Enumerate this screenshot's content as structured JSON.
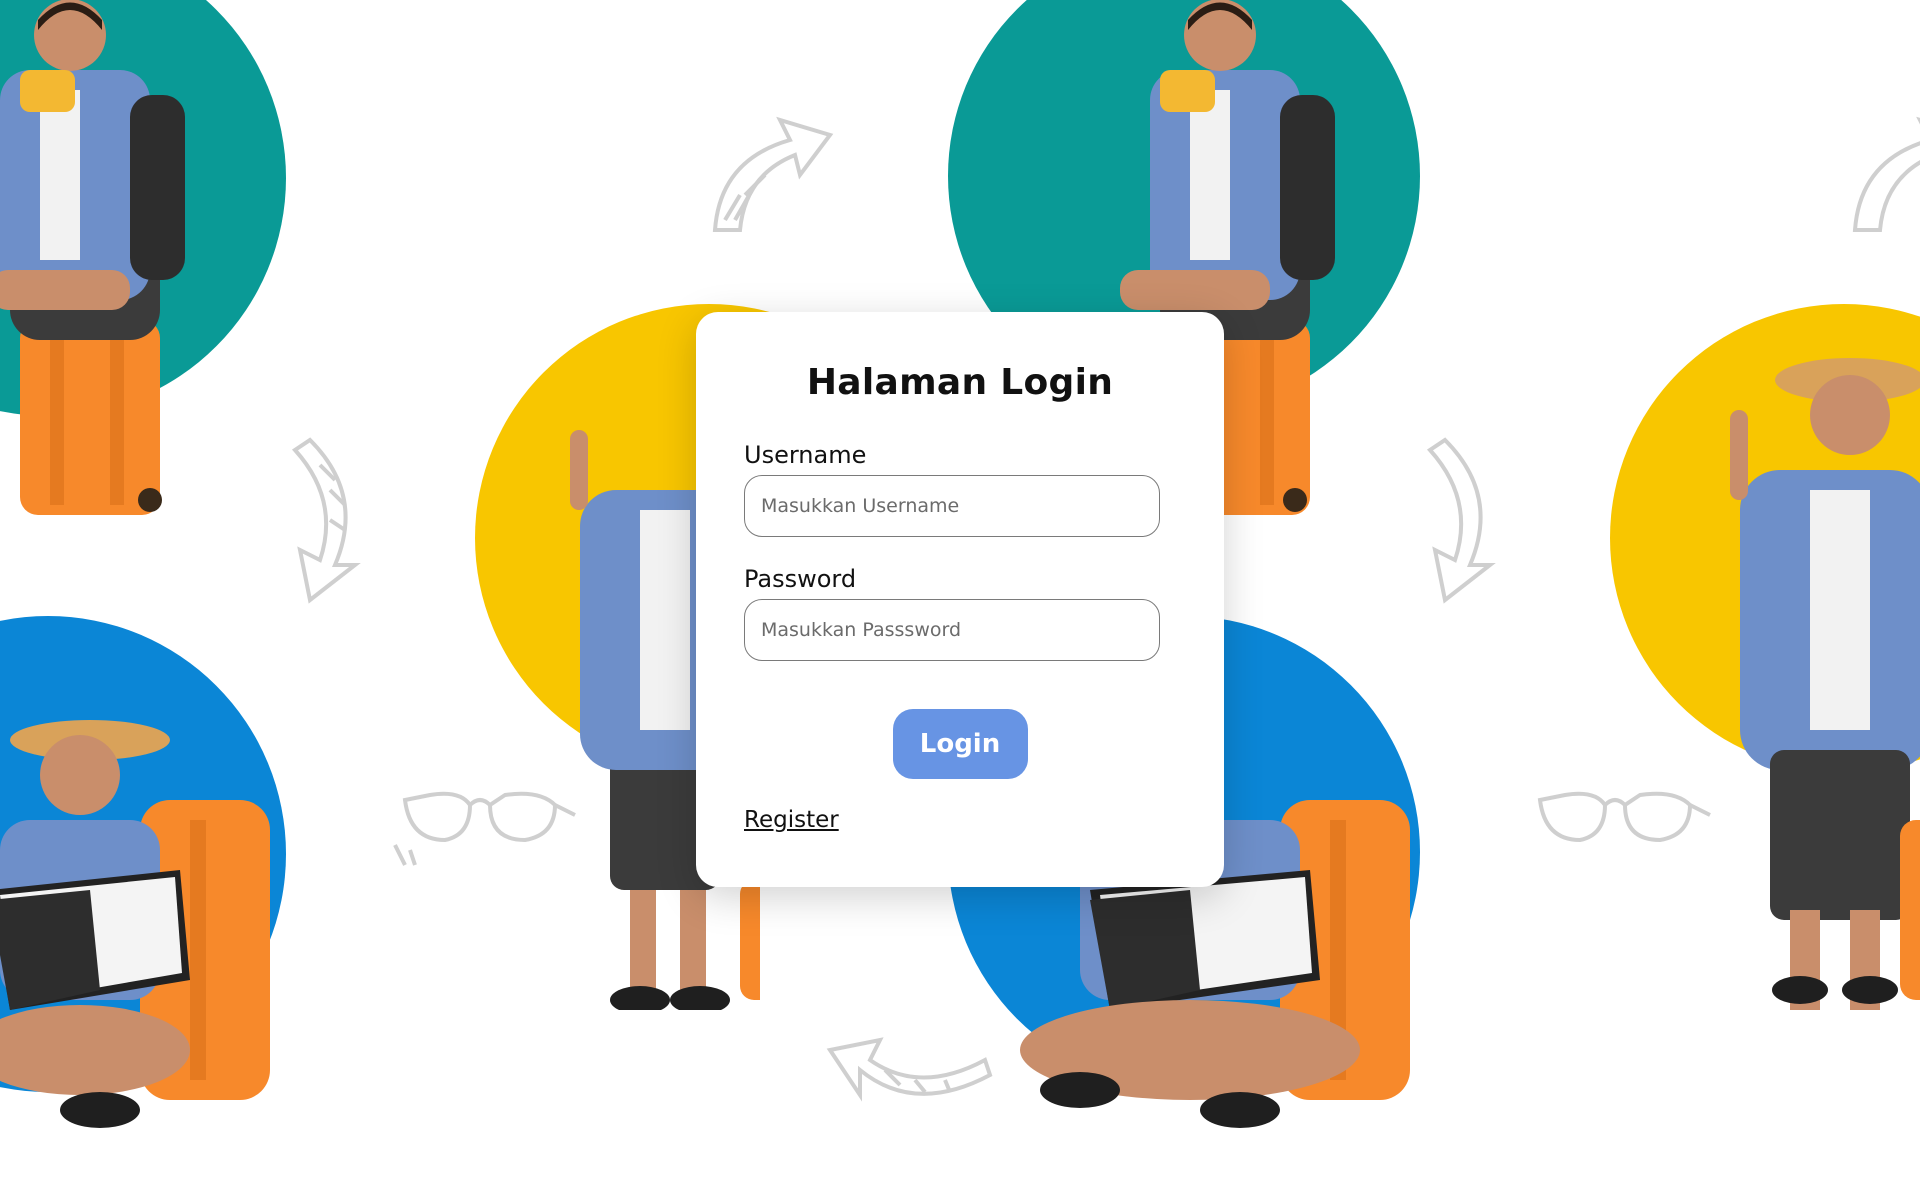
{
  "login": {
    "title": "Halaman Login",
    "username_label": "Username",
    "username_placeholder": "Masukkan Username",
    "username_value": "",
    "password_label": "Password",
    "password_placeholder": "Masukkan Passsword",
    "password_value": "",
    "login_button": "Login",
    "register_link": "Register"
  },
  "background": {
    "colors": {
      "teal": "#0a9a96",
      "yellow": "#f8c600",
      "blue": "#0b86d6",
      "suitcase": "#f7892b",
      "button": "#6794e4",
      "doodle": "#cfcfcf"
    },
    "doodles": [
      "arrow-doodle",
      "sunglasses-doodle"
    ]
  }
}
